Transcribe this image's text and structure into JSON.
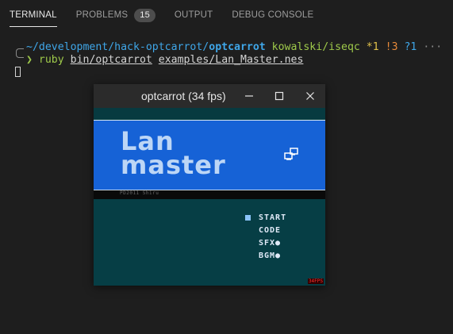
{
  "tabs": [
    {
      "label": "TERMINAL",
      "active": true
    },
    {
      "label": "PROBLEMS",
      "badge": "15"
    },
    {
      "label": "OUTPUT"
    },
    {
      "label": "DEBUG CONSOLE"
    }
  ],
  "terminal": {
    "prompt": {
      "path": "~/development/hack-optcarrot/",
      "dir": "optcarrot",
      "branch": "kowalski/iseqc",
      "status_modified": "*1",
      "status_untracked": "!3",
      "status_unknown": "?1",
      "more": "···"
    },
    "command": {
      "arrow": "❯",
      "cmd": "ruby",
      "arg1": "bin/optcarrot",
      "arg2": "examples/Lan_Master.nes"
    }
  },
  "window": {
    "title": "optcarrot (34 fps)",
    "minimize_glyph": "—",
    "maximize_glyph": "☐",
    "close_glyph": "✕"
  },
  "game": {
    "logo_line1": "Lan",
    "logo_line2": "master",
    "credit": "PD2011 Shiru",
    "menu": [
      "START",
      "CODE",
      "SFX●",
      "BGM●"
    ],
    "fps_badge": "34FPS"
  },
  "colors": {
    "nes_blue": "#1662d6",
    "nes_teal": "#063e45",
    "logo": "#bcd6f6"
  }
}
